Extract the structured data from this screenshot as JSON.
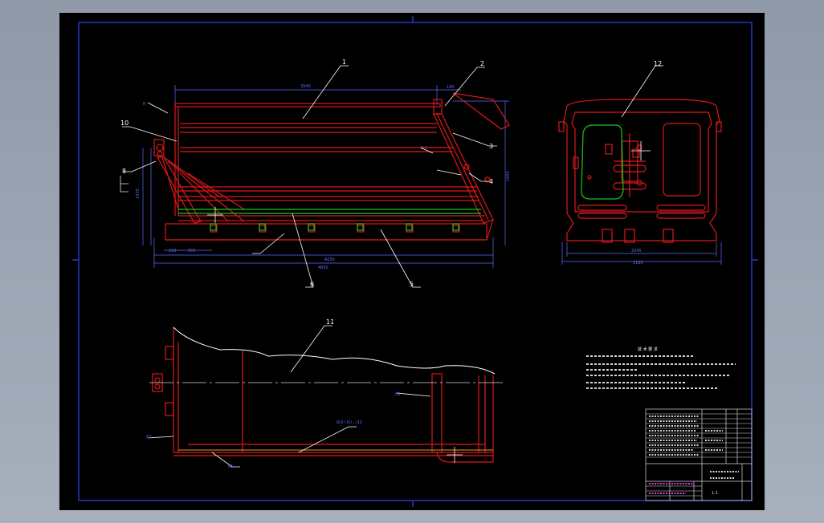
{
  "colors": {
    "background": "#000000",
    "frame": "#2a3bd6",
    "part": "#e01818",
    "leader": "#ffffff",
    "axis": "#d8d8d8",
    "rail": "#18c818",
    "dimension": "#5b6cff",
    "titleblock": "#d7d7d7",
    "magenta": "#e040e0"
  },
  "balloons": {
    "b1": "1",
    "b2": "2",
    "b3": "3",
    "b4": "4",
    "b5": "5",
    "b6": "6",
    "b8": "8",
    "b10": "10",
    "b11": "11",
    "b12": "12"
  }
}
